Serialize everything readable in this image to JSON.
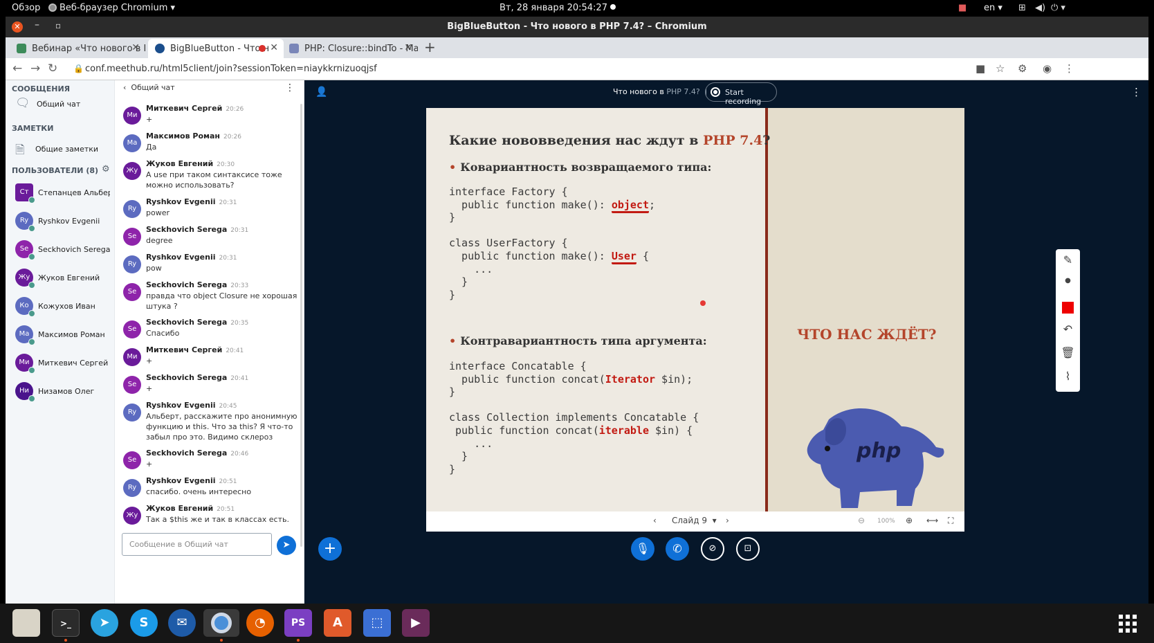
{
  "os_topbar": {
    "overview": "Обзор",
    "app_menu": "Веб-браузер Chromium",
    "clock": "Вт, 28 января  20:54:27",
    "language": "en"
  },
  "window": {
    "title": "BigBlueButton - Что нового в PHP 7.4? – Chromium"
  },
  "tabs": [
    {
      "label": "Вебинар «Что нового в P"
    },
    {
      "label": "BigBlueButton - Что н"
    },
    {
      "label": "PHP: Closure::bindTo - Ma"
    }
  ],
  "address_bar": {
    "url": "conf.meethub.ru/html5client/join?sessionToken=niaykkrnizuoqjsf"
  },
  "left_panel": {
    "messages_heading": "СООБЩЕНИЯ",
    "public_chat": "Общий чат",
    "notes_heading": "ЗАМЕТКИ",
    "shared_notes": "Общие заметки",
    "users_heading": "ПОЛЬЗОВАТЕЛИ (8)",
    "users": [
      {
        "initials": "Ст",
        "name": "Степанцев Альбер...",
        "color": "#6a1b9a"
      },
      {
        "initials": "Ry",
        "name": "Ryshkov Evgenii",
        "color": "#5c6bc0"
      },
      {
        "initials": "Se",
        "name": "Seckhovich Serega",
        "color": "#8e24aa"
      },
      {
        "initials": "Жу",
        "name": "Жуков Евгений",
        "color": "#6a1b9a"
      },
      {
        "initials": "Ко",
        "name": "Кожухов Иван",
        "color": "#5c6bc0"
      },
      {
        "initials": "Ма",
        "name": "Максимов Роман",
        "color": "#5c6bc0"
      },
      {
        "initials": "Ми",
        "name": "Миткевич Сергей",
        "color": "#6a1b9a"
      },
      {
        "initials": "Ни",
        "name": "Низамов Олег",
        "color": "#4a148c"
      }
    ]
  },
  "chat": {
    "title": "Общий чат",
    "input_placeholder": "Сообщение в Общий чат",
    "messages": [
      {
        "initials": "Ми",
        "name": "Миткевич Сергей",
        "time": "20:26",
        "text": "+",
        "color": "#6a1b9a"
      },
      {
        "initials": "Ма",
        "name": "Максимов Роман",
        "time": "20:26",
        "text": "Да",
        "color": "#5c6bc0"
      },
      {
        "initials": "Жу",
        "name": "Жуков Евгений",
        "time": "20:30",
        "text": "А use при таком синтаксисе тоже можно использовать?",
        "color": "#6a1b9a"
      },
      {
        "initials": "Ry",
        "name": "Ryshkov Evgenii",
        "time": "20:31",
        "text": "power",
        "color": "#5c6bc0"
      },
      {
        "initials": "Se",
        "name": "Seckhovich Serega",
        "time": "20:31",
        "text": "degree",
        "color": "#8e24aa"
      },
      {
        "initials": "Ry",
        "name": "Ryshkov Evgenii",
        "time": "20:31",
        "text": "pow",
        "color": "#5c6bc0"
      },
      {
        "initials": "Se",
        "name": "Seckhovich Serega",
        "time": "20:33",
        "text": "правда что object Closure не хорошая штука ?",
        "color": "#8e24aa"
      },
      {
        "initials": "Se",
        "name": "Seckhovich Serega",
        "time": "20:35",
        "text": "Спасибо",
        "color": "#8e24aa"
      },
      {
        "initials": "Ми",
        "name": "Миткевич Сергей",
        "time": "20:41",
        "text": "+",
        "color": "#6a1b9a"
      },
      {
        "initials": "Se",
        "name": "Seckhovich Serega",
        "time": "20:41",
        "text": "+",
        "color": "#8e24aa"
      },
      {
        "initials": "Ry",
        "name": "Ryshkov Evgenii",
        "time": "20:45",
        "text": "Альберт, расскажите про анонимную функцию и this. Что за this? Я что-то забыл про это. Видимо склероз",
        "color": "#5c6bc0"
      },
      {
        "initials": "Se",
        "name": "Seckhovich Serega",
        "time": "20:46",
        "text": "+",
        "color": "#8e24aa"
      },
      {
        "initials": "Ry",
        "name": "Ryshkov Evgenii",
        "time": "20:51",
        "text": "спасибо. очень интересно",
        "color": "#5c6bc0"
      },
      {
        "initials": "Жу",
        "name": "Жуков Евгений",
        "time": "20:51",
        "text": "Так а $this же и так в классах есть.",
        "color": "#6a1b9a"
      }
    ]
  },
  "presentation": {
    "title_prefix": "Что нового в",
    "title_suffix": "PHP 7.4?",
    "record_label": "Start recording",
    "slide": {
      "heading_prefix": "Какие нововведения нас ждут в",
      "heading_accent": "PHP 7.4",
      "heading_suffix": "?",
      "bullet1": "Ковариантность возвращаемого типа:",
      "bullet2": "Контравариантность типа аргумента:",
      "slogan": "ЧТО НАС ЖДЁТ?",
      "mascot_text": "php"
    },
    "controls": {
      "slide_label": "Слайд 9",
      "zoom": "100%"
    }
  }
}
